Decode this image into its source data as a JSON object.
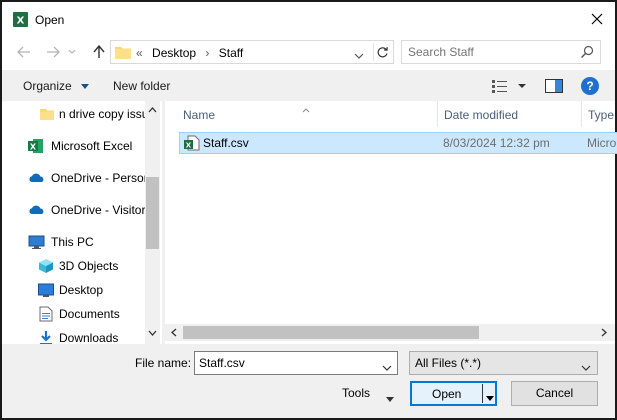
{
  "window": {
    "title": "Open"
  },
  "address": {
    "overflow": "«",
    "crumbs": [
      "Desktop",
      "Staff"
    ]
  },
  "search": {
    "placeholder": "Search Staff"
  },
  "toolbar": {
    "organize_label": "Organize",
    "new_folder_label": "New folder",
    "help_label": "?"
  },
  "sidebar": {
    "items": [
      {
        "label": "n drive copy issu",
        "icon": "folder-icon"
      },
      {
        "label": "Microsoft Excel",
        "icon": "excel-icon"
      },
      {
        "label": "OneDrive - Persor",
        "icon": "onedrive-icon"
      },
      {
        "label": "OneDrive - Visitor",
        "icon": "onedrive-icon"
      },
      {
        "label": "This PC",
        "icon": "pc-icon"
      },
      {
        "label": "3D Objects",
        "icon": "3d-objects-icon"
      },
      {
        "label": "Desktop",
        "icon": "desktop-icon"
      },
      {
        "label": "Documents",
        "icon": "documents-icon"
      },
      {
        "label": "Downloads",
        "icon": "downloads-icon"
      }
    ]
  },
  "files": {
    "columns": {
      "name": "Name",
      "date": "Date modified",
      "type": "Type"
    },
    "rows": [
      {
        "name": "Staff.csv",
        "date": "8/03/2024 12:32 pm",
        "type": "Micro"
      }
    ]
  },
  "bottom": {
    "file_name_label": "File name:",
    "file_name_value": "Staff.csv",
    "file_type_value": "All Files (*.*)",
    "tools_label": "Tools",
    "open_label": "Open",
    "cancel_label": "Cancel"
  },
  "colors": {
    "accent": "#0078d7",
    "selection": "#cce8ff",
    "excel": "#1d6f42"
  }
}
